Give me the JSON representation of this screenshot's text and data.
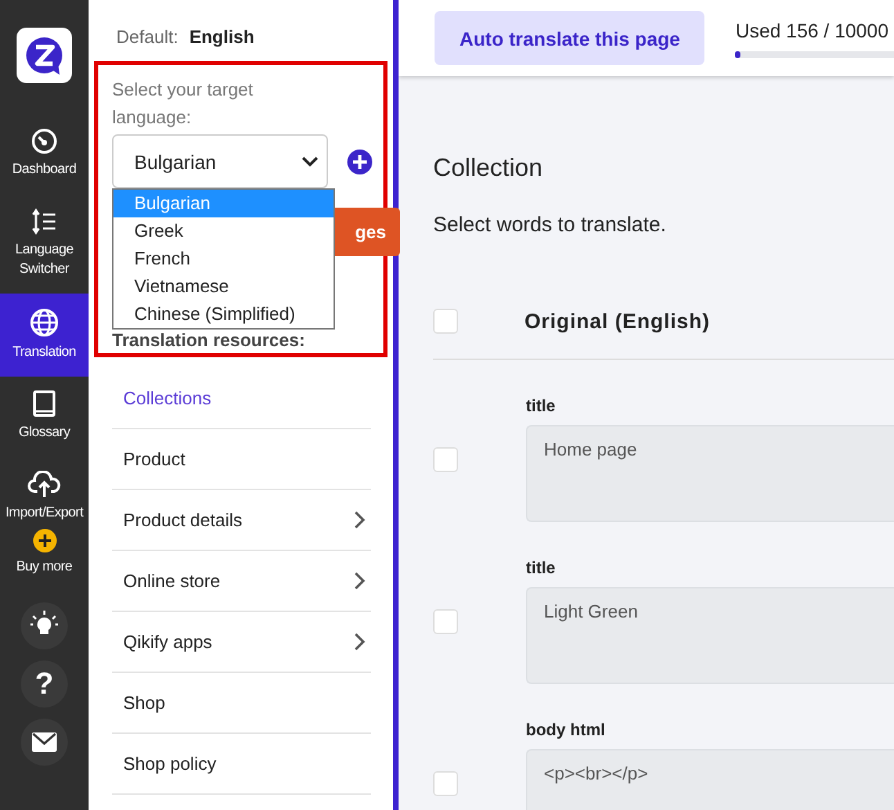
{
  "rail": {
    "items": [
      {
        "kind": "dashboard",
        "label": "Dashboard",
        "selected": false
      },
      {
        "kind": "switcher",
        "label": "Language Switcher",
        "selected": false
      },
      {
        "kind": "globe",
        "label": "Translation",
        "selected": true
      },
      {
        "kind": "book",
        "label": "Glossary",
        "selected": false
      },
      {
        "kind": "cloud",
        "label": "Import/Export",
        "selected": false
      },
      {
        "kind": "buy",
        "label": "Buy more",
        "selected": false
      }
    ],
    "help": "?"
  },
  "panel": {
    "default_label": "Default:",
    "default_value": "English",
    "target_label": "Select your target language:",
    "select": {
      "value": "Bulgarian",
      "options": [
        {
          "label": "Bulgarian",
          "selected": true
        },
        {
          "label": "Greek",
          "selected": false
        },
        {
          "label": "French",
          "selected": false
        },
        {
          "label": "Vietnamese",
          "selected": false
        },
        {
          "label": "Chinese (Simplified)",
          "selected": false
        }
      ]
    },
    "action_button": "ges",
    "resources_label": "Translation resources:",
    "resources": [
      {
        "label": "Collections",
        "selected": true,
        "has_children": false
      },
      {
        "label": "Product",
        "selected": false,
        "has_children": false
      },
      {
        "label": "Product details",
        "selected": false,
        "has_children": true
      },
      {
        "label": "Online store",
        "selected": false,
        "has_children": true
      },
      {
        "label": "Qikify apps",
        "selected": false,
        "has_children": true
      },
      {
        "label": "Shop",
        "selected": false,
        "has_children": false
      },
      {
        "label": "Shop policy",
        "selected": false,
        "has_children": false
      }
    ]
  },
  "topbar": {
    "auto_button": "Auto translate this page",
    "usage": "Used 156 / 10000",
    "level": 0.0156
  },
  "main": {
    "title": "Collection",
    "subtitle": "Select words to translate.",
    "header": {
      "label": "Original (English)",
      "checked": false
    },
    "fields": [
      {
        "label": "title",
        "value": "Home page",
        "checked": false
      },
      {
        "label": "title",
        "value": "Light Green",
        "checked": false
      },
      {
        "label": "body html",
        "value": "<p><br></p>",
        "checked": false
      }
    ]
  }
}
